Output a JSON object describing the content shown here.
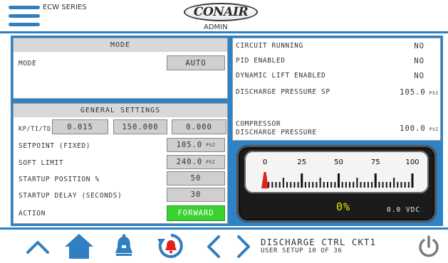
{
  "header": {
    "series": "ECW SERIES",
    "logo_text": "CONAIR",
    "user_level": "ADMIN"
  },
  "mode_panel": {
    "title": "MODE",
    "mode_label": "MODE",
    "mode_value": "AUTO"
  },
  "general_settings": {
    "title": "GENERAL SETTINGS",
    "pid_label": "KP/TI/TD",
    "kp": "0.015",
    "ti": "150.000",
    "td": "0.000",
    "rows": [
      {
        "label": "SETPOINT (FIXED)",
        "value": "105.0",
        "unit": "PSI"
      },
      {
        "label": "SOFT LIMIT",
        "value": "240.0",
        "unit": "PSI"
      },
      {
        "label": "STARTUP POSITION %",
        "value": "50",
        "unit": ""
      },
      {
        "label": "STARTUP DELAY (SECONDS)",
        "value": "30",
        "unit": ""
      },
      {
        "label": "ACTION",
        "value": "FORWARD",
        "unit": ""
      }
    ]
  },
  "status": {
    "items": [
      {
        "label": "CIRCUIT RUNNING",
        "value": "NO"
      },
      {
        "label": "PID ENABLED",
        "value": "NO"
      },
      {
        "label": "DYNAMIC LIFT ENABLED",
        "value": "NO"
      },
      {
        "label": "DISCHARGE PRESSURE SP",
        "value": "105.0",
        "unit": "PSI"
      }
    ],
    "compressor_label_1": "COMPRESSOR",
    "compressor_label_2": "DISCHARGE PRESSURE",
    "compressor_value": "100.0",
    "compressor_unit": "PSI"
  },
  "gauge": {
    "scale_labels": [
      "0",
      "25",
      "50",
      "75",
      "100"
    ],
    "needle_percent": 0,
    "percent_text": "0%",
    "voltage_text": "0.0 VDC"
  },
  "footer": {
    "title": "DISCHARGE CTRL CKT1",
    "subtitle": "USER SETUP 10 OF 36"
  },
  "colors": {
    "accent_blue": "#2e82c6",
    "action_green": "#39d12f",
    "alarm_red": "#e0241b",
    "percent_yellow": "#f4e300"
  },
  "icons": {
    "menu": "hamburger-icon",
    "up": "chevron-up-icon",
    "home": "home-icon",
    "alarm": "bell-icon",
    "alarm_history": "alarm-history-icon",
    "prev": "chevron-left-icon",
    "next": "chevron-right-icon",
    "power": "power-icon"
  }
}
